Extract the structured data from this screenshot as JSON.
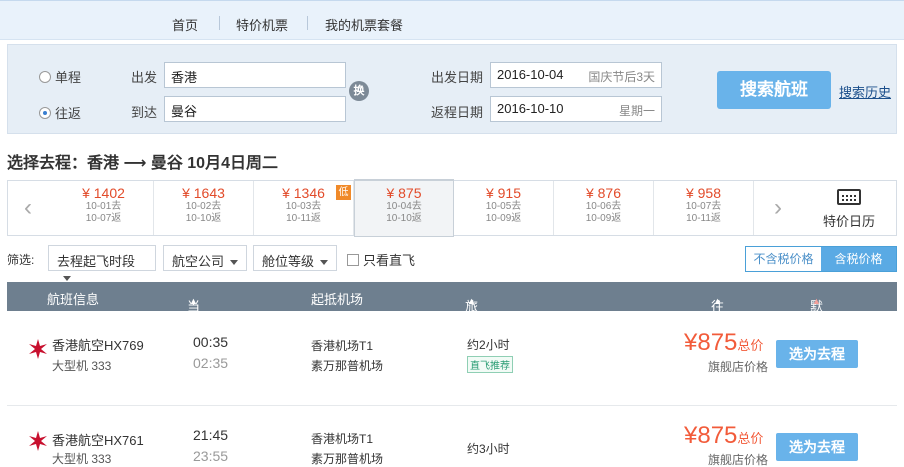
{
  "nav": {
    "items": [
      "首页",
      "特价机票",
      "我的机票套餐"
    ]
  },
  "search": {
    "trip_types": [
      "单程",
      "往返"
    ],
    "selected_trip": "往返",
    "from_label": "出发",
    "to_label": "到达",
    "from_value": "香港",
    "to_value": "曼谷",
    "swap_label": "换",
    "depart_label": "出发日期",
    "return_label": "返程日期",
    "depart_date": "2016-10-04",
    "depart_hint": "国庆节后3天",
    "return_date": "2016-10-10",
    "return_hint": "星期一",
    "search_button": "搜索航班",
    "history_link": "搜索历史"
  },
  "route_title": "选择去程：香港 ⟶ 曼谷  10月4日周二",
  "date_strip": {
    "days": [
      {
        "price": "¥ 1402",
        "go": "10-01去",
        "back": "10-07返"
      },
      {
        "price": "¥ 1643",
        "go": "10-02去",
        "back": "10-10返"
      },
      {
        "price": "¥ 1346",
        "go": "10-03去",
        "back": "10-11返",
        "low_tag": "低"
      },
      {
        "price": "¥ 875",
        "go": "10-04去",
        "back": "10-10返",
        "selected": true
      },
      {
        "price": "¥ 915",
        "go": "10-05去",
        "back": "10-09返"
      },
      {
        "price": "¥ 876",
        "go": "10-06去",
        "back": "10-09返"
      },
      {
        "price": "¥ 958",
        "go": "10-07去",
        "back": "10-11返"
      }
    ],
    "calendar_label": "特价日历"
  },
  "filters": {
    "label": "筛选:",
    "dropdowns": [
      "去程起飞时段",
      "航空公司",
      "舱位等级"
    ],
    "direct_only": "只看直飞",
    "tax_off": "不含税价格",
    "tax_on": "含税价格"
  },
  "table_header": {
    "flight": "航班信息",
    "time": "当地起降时间",
    "airport": "起抵机场",
    "duration": "旅行总时长",
    "price": "往返 价格",
    "sort": "默认排序"
  },
  "flights": [
    {
      "airline": "香港航空HX769",
      "plane": "大型机 333",
      "dep_time": "00:35",
      "arr_time": "02:35",
      "dep_airport": "香港机场T1",
      "arr_airport": "素万那普机场",
      "duration": "约2小时",
      "direct_tag": "直飞推荐",
      "price": "¥875",
      "price_unit": "总价",
      "store": "旗舰店价格",
      "button": "选为去程"
    },
    {
      "airline": "香港航空HX761",
      "plane": "大型机 333",
      "dep_time": "21:45",
      "arr_time": "23:55",
      "dep_airport": "香港机场T1",
      "arr_airport": "素万那普机场",
      "duration": "约3小时",
      "price": "¥875",
      "price_unit": "总价",
      "store": "旗舰店价格",
      "button": "选为去程"
    }
  ],
  "colors": {
    "accent": "#69b3ea",
    "price": "#f25b3a",
    "header": "#6e7f8f"
  }
}
